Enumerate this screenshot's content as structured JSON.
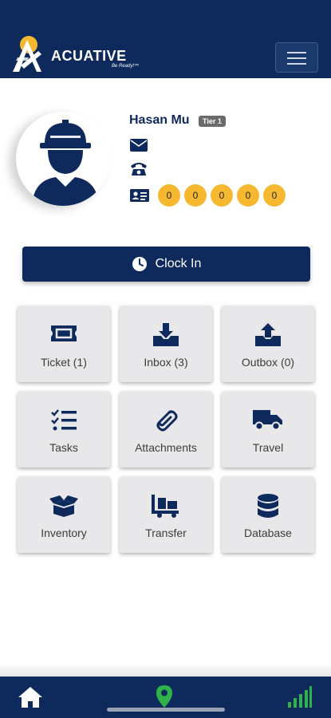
{
  "header": {
    "brand": "ACUATIVE",
    "tagline": "Be Ready!™",
    "menu_icon": "hamburger-menu-icon"
  },
  "profile": {
    "name": "Hasan Mu",
    "tier": "Tier 1",
    "icons": [
      "envelope-icon",
      "phone-icon",
      "id-card-icon"
    ],
    "coins": [
      "0",
      "0",
      "0",
      "0",
      "0"
    ]
  },
  "clock_in": {
    "label": "Clock In",
    "icon": "clock-icon"
  },
  "tiles": [
    {
      "label": "Ticket (1)",
      "icon": "ticket-icon"
    },
    {
      "label": "Inbox (3)",
      "icon": "inbox-download-icon"
    },
    {
      "label": "Outbox (0)",
      "icon": "outbox-upload-icon"
    },
    {
      "label": "Tasks",
      "icon": "task-list-icon"
    },
    {
      "label": "Attachments",
      "icon": "paperclip-icon"
    },
    {
      "label": "Travel",
      "icon": "truck-icon"
    },
    {
      "label": "Inventory",
      "icon": "open-box-icon"
    },
    {
      "label": "Transfer",
      "icon": "dolly-icon"
    },
    {
      "label": "Database",
      "icon": "database-icon"
    }
  ],
  "bottom_nav": {
    "items": [
      "home-icon",
      "location-pin-icon",
      "signal-icon"
    ]
  },
  "colors": {
    "primary": "#0e2a5c",
    "coin": "#f5b82e",
    "nav_active": "#2fb24c",
    "tile_bg": "#e8e8ea"
  }
}
